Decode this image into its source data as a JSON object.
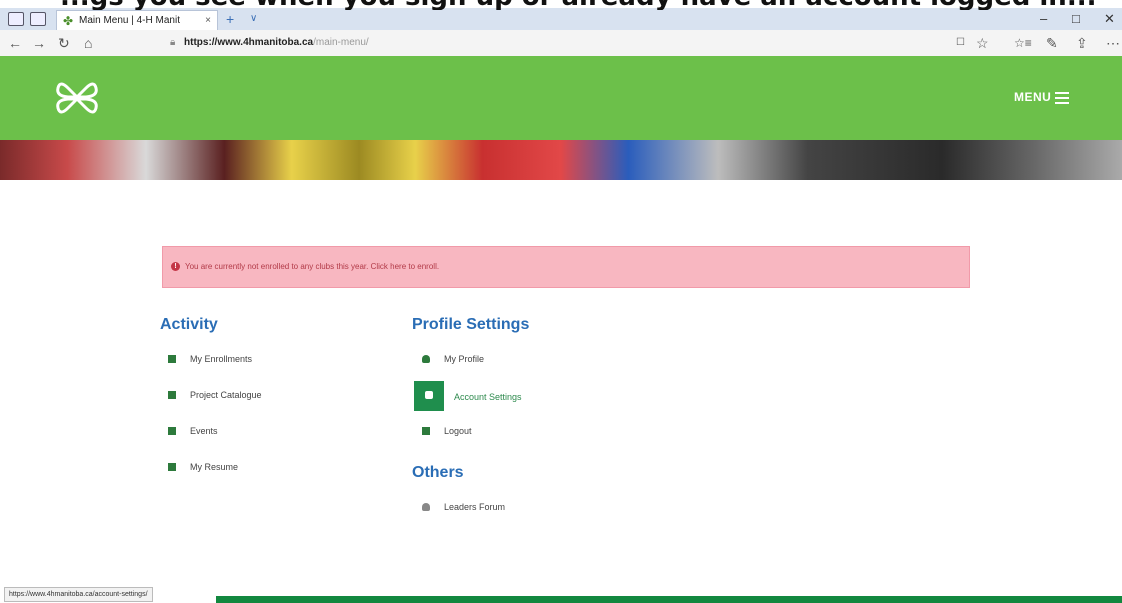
{
  "caption": "...gs you see when you sign up or already have an account logged in...",
  "browser": {
    "tab_title": "Main Menu | 4-H Manit",
    "tab_close": "×",
    "new_tab": "+",
    "tab_dropdown": "∨",
    "url_host": "https://www.4hmanitoba.ca",
    "url_path": "/main-menu/",
    "window_controls": [
      "–",
      "□",
      "✕"
    ],
    "nav_icons": [
      "←",
      "→",
      "↻",
      "⌂"
    ],
    "toolbar_icons": [
      "☐",
      "☆",
      "☆≡",
      "✎",
      "⇪",
      "⋯"
    ]
  },
  "site": {
    "menu_label": "MENU",
    "colors": {
      "header_green": "#6cc04a",
      "link_blue": "#2a6db5",
      "active_green": "#1f8e4d"
    }
  },
  "alert": {
    "icon": "!",
    "text": "You are currently not enrolled to any clubs this year. Click here to enroll."
  },
  "activity": {
    "title": "Activity",
    "items": [
      {
        "label": "My Enrollments",
        "icon": "enrollments-icon"
      },
      {
        "label": "Project Catalogue",
        "icon": "catalogue-icon"
      },
      {
        "label": "Events",
        "icon": "calendar-icon"
      },
      {
        "label": "My Resume",
        "icon": "resume-icon"
      }
    ]
  },
  "profile": {
    "title": "Profile Settings",
    "items": [
      {
        "label": "My Profile",
        "icon": "user-icon"
      },
      {
        "label": "Account Settings",
        "icon": "lock-icon",
        "active": true
      },
      {
        "label": "Logout",
        "icon": "logout-icon"
      }
    ]
  },
  "others": {
    "title": "Others",
    "items": [
      {
        "label": "Leaders Forum",
        "icon": "forum-icon"
      }
    ]
  },
  "status_url": "https://www.4hmanitoba.ca/account-settings/"
}
